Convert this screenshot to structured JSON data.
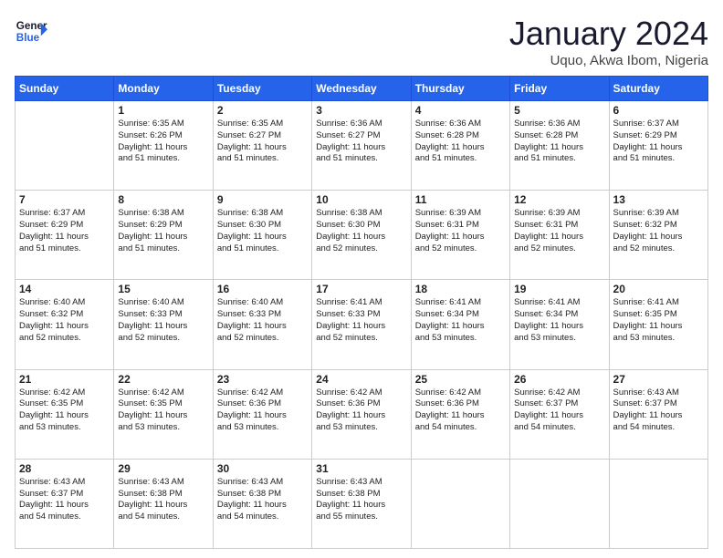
{
  "header": {
    "logo_line1": "General",
    "logo_line2": "Blue",
    "month": "January 2024",
    "location": "Uquo, Akwa Ibom, Nigeria"
  },
  "days_of_week": [
    "Sunday",
    "Monday",
    "Tuesday",
    "Wednesday",
    "Thursday",
    "Friday",
    "Saturday"
  ],
  "weeks": [
    [
      {
        "day": "",
        "info": ""
      },
      {
        "day": "1",
        "info": "Sunrise: 6:35 AM\nSunset: 6:26 PM\nDaylight: 11 hours\nand 51 minutes."
      },
      {
        "day": "2",
        "info": "Sunrise: 6:35 AM\nSunset: 6:27 PM\nDaylight: 11 hours\nand 51 minutes."
      },
      {
        "day": "3",
        "info": "Sunrise: 6:36 AM\nSunset: 6:27 PM\nDaylight: 11 hours\nand 51 minutes."
      },
      {
        "day": "4",
        "info": "Sunrise: 6:36 AM\nSunset: 6:28 PM\nDaylight: 11 hours\nand 51 minutes."
      },
      {
        "day": "5",
        "info": "Sunrise: 6:36 AM\nSunset: 6:28 PM\nDaylight: 11 hours\nand 51 minutes."
      },
      {
        "day": "6",
        "info": "Sunrise: 6:37 AM\nSunset: 6:29 PM\nDaylight: 11 hours\nand 51 minutes."
      }
    ],
    [
      {
        "day": "7",
        "info": "Sunrise: 6:37 AM\nSunset: 6:29 PM\nDaylight: 11 hours\nand 51 minutes."
      },
      {
        "day": "8",
        "info": "Sunrise: 6:38 AM\nSunset: 6:29 PM\nDaylight: 11 hours\nand 51 minutes."
      },
      {
        "day": "9",
        "info": "Sunrise: 6:38 AM\nSunset: 6:30 PM\nDaylight: 11 hours\nand 51 minutes."
      },
      {
        "day": "10",
        "info": "Sunrise: 6:38 AM\nSunset: 6:30 PM\nDaylight: 11 hours\nand 52 minutes."
      },
      {
        "day": "11",
        "info": "Sunrise: 6:39 AM\nSunset: 6:31 PM\nDaylight: 11 hours\nand 52 minutes."
      },
      {
        "day": "12",
        "info": "Sunrise: 6:39 AM\nSunset: 6:31 PM\nDaylight: 11 hours\nand 52 minutes."
      },
      {
        "day": "13",
        "info": "Sunrise: 6:39 AM\nSunset: 6:32 PM\nDaylight: 11 hours\nand 52 minutes."
      }
    ],
    [
      {
        "day": "14",
        "info": "Sunrise: 6:40 AM\nSunset: 6:32 PM\nDaylight: 11 hours\nand 52 minutes."
      },
      {
        "day": "15",
        "info": "Sunrise: 6:40 AM\nSunset: 6:33 PM\nDaylight: 11 hours\nand 52 minutes."
      },
      {
        "day": "16",
        "info": "Sunrise: 6:40 AM\nSunset: 6:33 PM\nDaylight: 11 hours\nand 52 minutes."
      },
      {
        "day": "17",
        "info": "Sunrise: 6:41 AM\nSunset: 6:33 PM\nDaylight: 11 hours\nand 52 minutes."
      },
      {
        "day": "18",
        "info": "Sunrise: 6:41 AM\nSunset: 6:34 PM\nDaylight: 11 hours\nand 53 minutes."
      },
      {
        "day": "19",
        "info": "Sunrise: 6:41 AM\nSunset: 6:34 PM\nDaylight: 11 hours\nand 53 minutes."
      },
      {
        "day": "20",
        "info": "Sunrise: 6:41 AM\nSunset: 6:35 PM\nDaylight: 11 hours\nand 53 minutes."
      }
    ],
    [
      {
        "day": "21",
        "info": "Sunrise: 6:42 AM\nSunset: 6:35 PM\nDaylight: 11 hours\nand 53 minutes."
      },
      {
        "day": "22",
        "info": "Sunrise: 6:42 AM\nSunset: 6:35 PM\nDaylight: 11 hours\nand 53 minutes."
      },
      {
        "day": "23",
        "info": "Sunrise: 6:42 AM\nSunset: 6:36 PM\nDaylight: 11 hours\nand 53 minutes."
      },
      {
        "day": "24",
        "info": "Sunrise: 6:42 AM\nSunset: 6:36 PM\nDaylight: 11 hours\nand 53 minutes."
      },
      {
        "day": "25",
        "info": "Sunrise: 6:42 AM\nSunset: 6:36 PM\nDaylight: 11 hours\nand 54 minutes."
      },
      {
        "day": "26",
        "info": "Sunrise: 6:42 AM\nSunset: 6:37 PM\nDaylight: 11 hours\nand 54 minutes."
      },
      {
        "day": "27",
        "info": "Sunrise: 6:43 AM\nSunset: 6:37 PM\nDaylight: 11 hours\nand 54 minutes."
      }
    ],
    [
      {
        "day": "28",
        "info": "Sunrise: 6:43 AM\nSunset: 6:37 PM\nDaylight: 11 hours\nand 54 minutes."
      },
      {
        "day": "29",
        "info": "Sunrise: 6:43 AM\nSunset: 6:38 PM\nDaylight: 11 hours\nand 54 minutes."
      },
      {
        "day": "30",
        "info": "Sunrise: 6:43 AM\nSunset: 6:38 PM\nDaylight: 11 hours\nand 54 minutes."
      },
      {
        "day": "31",
        "info": "Sunrise: 6:43 AM\nSunset: 6:38 PM\nDaylight: 11 hours\nand 55 minutes."
      },
      {
        "day": "",
        "info": ""
      },
      {
        "day": "",
        "info": ""
      },
      {
        "day": "",
        "info": ""
      }
    ]
  ]
}
